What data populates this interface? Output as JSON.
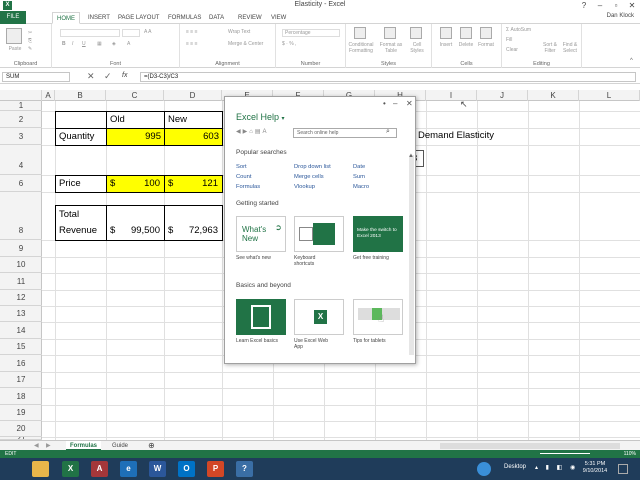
{
  "window": {
    "title": "Elasticity - Excel",
    "user": "Dan Klock"
  },
  "tabs": [
    "FILE",
    "HOME",
    "INSERT",
    "PAGE LAYOUT",
    "FORMULAS",
    "DATA",
    "REVIEW",
    "VIEW"
  ],
  "ribbon": {
    "groups": [
      "Clipboard",
      "Font",
      "Alignment",
      "Number",
      "Styles",
      "Cells",
      "Editing"
    ],
    "paste": "Paste",
    "wrap_text": "Wrap Text",
    "merge_center": "Merge & Center",
    "number_format": "Percentage",
    "conditional_formatting": "Conditional Formatting",
    "format_as_table": "Format as Table",
    "cell_styles": "Cell Styles",
    "insert": "Insert",
    "delete": "Delete",
    "format": "Format",
    "autosum": "AutoSum",
    "fill": "Fill",
    "clear": "Clear",
    "sort_filter": "Sort & Filter",
    "find_select": "Find & Select"
  },
  "formula_bar": {
    "name_box": "SUM",
    "fx": "fx",
    "formula": "=(D3-C3)/C3"
  },
  "columns": [
    "A",
    "B",
    "C",
    "D",
    "E",
    "F",
    "G",
    "H",
    "I",
    "J",
    "K",
    "L"
  ],
  "rows": [
    "1",
    "2",
    "3",
    "4",
    "6",
    "8",
    "9",
    "10",
    "11",
    "12",
    "13",
    "14",
    "15",
    "16",
    "17",
    "18",
    "19",
    "20",
    "21"
  ],
  "cells": {
    "b3": "Quantity",
    "c2": "Old",
    "d2": "New",
    "c3": "995",
    "d3": "603",
    "b6": "Price",
    "c6_sym": "$",
    "c6": "100",
    "d6_sym": "$",
    "d6": "121",
    "b8_line1": "Total",
    "b8_line2": "Revenue",
    "c8_sym": "$",
    "c8": "99,500",
    "d8_sym": "$",
    "d8": "72,963",
    "h3": "Demand Elasticity",
    "h4": "3"
  },
  "help": {
    "title": "Excel Help",
    "search_placeholder": "Search online help",
    "popular_heading": "Popular searches",
    "popular": [
      "Sort",
      "Drop down list",
      "Date",
      "Count",
      "Merge cells",
      "Sum",
      "Formulas",
      "Vlookup",
      "Macro"
    ],
    "getting_started_heading": "Getting started",
    "whats_new_tile": "What's New",
    "switch_tile": "Make the switch to Excel 2013",
    "getting_started": [
      "See what's new",
      "Keyboard shortcuts",
      "Get free training"
    ],
    "basics_heading": "Basics and beyond",
    "basics": [
      "Learn Excel basics",
      "Use Excel Web App",
      "Tips for tablets"
    ]
  },
  "sheets": [
    "Formulas",
    "Guide"
  ],
  "status": {
    "mode": "EDIT",
    "zoom": "110%"
  },
  "taskbar": {
    "desktop": "Desktop",
    "time": "5:31 PM",
    "date": "9/10/2014"
  }
}
